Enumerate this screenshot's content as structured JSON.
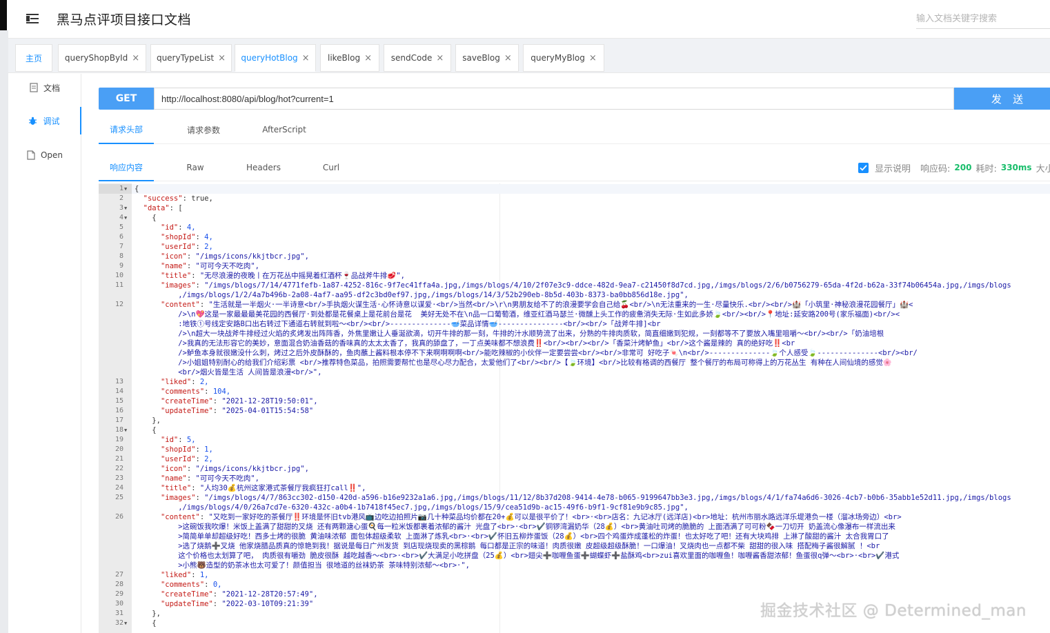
{
  "app": {
    "title": "黑马点评项目接口文档",
    "search_placeholder": "输入文档关键字搜索"
  },
  "tabs": [
    {
      "label": "主页"
    },
    {
      "label": "queryShopById"
    },
    {
      "label": "queryTypeList"
    },
    {
      "label": "queryHotBlog"
    },
    {
      "label": "likeBlog"
    },
    {
      "label": "sendCode"
    },
    {
      "label": "saveBlog"
    },
    {
      "label": "queryMyBlog"
    }
  ],
  "sidebar": {
    "items": [
      {
        "label": "文档"
      },
      {
        "label": "调试"
      },
      {
        "label": "Open"
      }
    ]
  },
  "request": {
    "method": "GET",
    "url": "http://localhost:8080/api/blog/hot?current=1",
    "send_label": "发 送"
  },
  "request_tabs": [
    {
      "label": "请求头部"
    },
    {
      "label": "请求参数"
    },
    {
      "label": "AfterScript"
    }
  ],
  "response_tabs": [
    {
      "label": "响应内容"
    },
    {
      "label": "Raw"
    },
    {
      "label": "Headers"
    },
    {
      "label": "Curl"
    }
  ],
  "response_meta": {
    "show_desc_label": "显示说明",
    "code_label": "响应码:",
    "code": "200",
    "time_label": "耗时:",
    "time": "330ms",
    "size_label": "大小"
  },
  "code_lines": [
    {
      "n": "1",
      "fold": true,
      "t": "{"
    },
    {
      "n": "2",
      "t": "  \"success\": true,"
    },
    {
      "n": "3",
      "fold": true,
      "t": "  \"data\": ["
    },
    {
      "n": "4",
      "fold": true,
      "t": "    {"
    },
    {
      "n": "5",
      "t": "      \"id\": 4,"
    },
    {
      "n": "6",
      "t": "      \"shopId\": 4,"
    },
    {
      "n": "7",
      "t": "      \"userId\": 2,"
    },
    {
      "n": "8",
      "t": "      \"icon\": \"/imgs/icons/kkjtbcr.jpg\","
    },
    {
      "n": "9",
      "t": "      \"name\": \"可可今天不吃肉\","
    },
    {
      "n": "10",
      "t": "      \"title\": \"无尽浪漫的夜晚丨在万花丛中摇晃着红酒杯🍷品战斧牛排🥩\","
    },
    {
      "n": "11",
      "t": "      \"images\": \"/imgs/blogs/7/14/4771fefb-1a87-4252-816c-9f7ec41ffa4a.jpg,/imgs/blogs/4/10/2f07e3c9-ddce-482d-9ea7-c21450f8d7cd.jpg,/imgs/blogs/2/6/b0756279-65da-4f2d-b62a-33f74b06454a.jpg,/imgs/blogs"
    },
    {
      "n": "",
      "t": "          ,/imgs/blogs/1/2/4a7b496b-2a08-4af7-aa95-df2c3bd0ef97.jpg,/imgs/blogs/14/3/52b290eb-8b5d-403b-8373-ba0bb856d18e.jpg\","
    },
    {
      "n": "12",
      "t": "      \"content\": \"生活就是一半烟火·一半诗意<br/>手执烟火谋生活·心怀诗意以谋爱·<br/>当然<br/>\\r\\n男朋友给不了的浪漫要学会自己给🍒<br/>\\n无法重来的一生·尽量快乐.<br/><br/>🏰「小筑里·神秘浪漫花园餐厅」🏰<"
    },
    {
      "n": "",
      "t": "          />\\n💖这是一家最最最美花园的西餐厅·到处都是花餐桌上是花前台是花  美好无处不在\\n品一口葡萄酒，维亚红酒马瑟兰·微醺上头工作的疲惫消失无际·生如此多娇🍃<br/><br/>📍地址:延安路200号(家乐福面)<br/><"
    },
    {
      "n": "",
      "t": "          :地铁①号线定安路B口出右转过下通道右转就到啦～<br/><br/>--------------🥣菜品详情🥣---------------<br/><br/>「战斧牛排]<br"
    },
    {
      "n": "",
      "t": "          />\\n超大一块战斧牛排经过火焰的炙烤发出阵阵香，外焦里嫩让人垂涎欲滴，切开牛排的那一刻，牛排的汁水顺势流了出来，分熟的牛排肉质软，简直细嫩到犯规，一刻都等不了要放入嘴里咀嚼～<br/><br/>「奶油培根"
    },
    {
      "n": "",
      "t": "          />我真的无法形容它的美妙，意面混合奶油香菇的香味真的太太太香了，我真的舔盘了，一丁点美味都不想浪费‼️<br/><br/><br/>「香菜汁烤鲈鱼」<br/>这个酱是辣的 真的绝好吃‼️<br"
    },
    {
      "n": "",
      "t": "          />鲈鱼本身就很嫩没什么刺，烤过之后外皮酥酥的，鱼肉蘸上酱料根本停不下来啊啊啊啊<br/>能吃辣椒的小伙伴一定要尝尝<br/><br/>非常可 好吃子🍬\\n<br/>--------------🍃个人感受🍃--------------<br/><br/"
    },
    {
      "n": "",
      "t": "          />小姐姐特别耐心的给我们介绍彩票 <br/>推荐特色菜品，拍照需要帮忙也是尽心尽力配合，太爱他们了<br/><br/>【🍃环境】<br/>比较有格调的西餐厅 整个餐厅的布局可称得上的万花丛生 有种在人间仙境的感觉🌸"
    },
    {
      "n": "",
      "t": "          <br/>烟火皆是生活 人间皆是浪漫<br/>\","
    },
    {
      "n": "13",
      "t": "      \"liked\": 2,"
    },
    {
      "n": "14",
      "t": "      \"comments\": 104,"
    },
    {
      "n": "15",
      "t": "      \"createTime\": \"2021-12-28T19:50:01\","
    },
    {
      "n": "16",
      "t": "      \"updateTime\": \"2025-04-01T15:54:58\""
    },
    {
      "n": "17",
      "t": "    },"
    },
    {
      "n": "18",
      "fold": true,
      "t": "    {"
    },
    {
      "n": "19",
      "t": "      \"id\": 5,"
    },
    {
      "n": "20",
      "t": "      \"shopId\": 1,"
    },
    {
      "n": "21",
      "t": "      \"userId\": 2,"
    },
    {
      "n": "22",
      "t": "      \"icon\": \"/imgs/icons/kkjtbcr.jpg\","
    },
    {
      "n": "23",
      "t": "      \"name\": \"可可今天不吃肉\","
    },
    {
      "n": "24",
      "t": "      \"title\": \"人均30💰杭州这家港式茶餐厅我疯狂打call‼️\","
    },
    {
      "n": "25",
      "t": "      \"images\": \"/imgs/blogs/4/7/863cc302-d150-420d-a596-b16e9232a1a6.jpg,/imgs/blogs/11/12/8b37d208-9414-4e78-b065-9199647bb3e3.jpg,/imgs/blogs/4/1/fa74a6d6-3026-4cb7-b0b6-35abb1e52d11.jpg,/imgs/blogs"
    },
    {
      "n": "",
      "t": "          ,/imgs/blogs/4/0/26a7cd7e-6320-432c-a0b4-1b7418f45ec7.jpg,/imgs/blogs/15/9/cea51d9b-ac15-49f6-b9f1-9cf81e9b9c85.jpg\","
    },
    {
      "n": "26",
      "t": "      \"content\": \"又吃到一家好吃的茶餐厅‼️环境是怀旧tvb港风📺边吃边拍照片📷几十种菜品均价都在20+💰可以是很平价了！<br>·<br>店名：九记冰厅(远洋店)<br>地址：杭州市丽水路远洋乐堤港负一楼（溜冰场旁边）<br>"
    },
    {
      "n": "",
      "t": "          >这碗饭我吹爆！米饭上盖满了甜甜的叉烧 还有两颗溏心蛋🍳每一粒米饭都裹着浓郁的酱汁 光盘了<br>·<br>✔️铜锣湾漏奶华（28💰）<br>黄油吐司烤的脆脆的 上面洒满了可可粉🍫一刀切开 奶盖流心像瀑布一样流出来"
    },
    {
      "n": "",
      "t": "          >简简单单却超级好吃！西多士烤的很脆 黄油味浓郁 面包体超级柔软 上面淋了炼乳<br>·<br>✔️怀旧五柳炸蛋饭（28💰）<br>四个鸡蛋炸成蓬松的炸蛋！也太好吃了吧！还有大块鸡排 上淋了酸甜的酱汁 太合我胃口了"
    },
    {
      "n": "",
      "t": "          >选了烧鹅➕叉烧 他家烧腊品质真的惊艳到我！据说是每日广州发货 到店现烧现卖的黑棕鹅 每口都是正宗的味道！肉质很嫩 皮超级超级酥脆！一口爆油！叉烧肉也一点都不柴 甜甜的很入味 搭配梅子酱很解腻 ！<br"
    },
    {
      "n": "",
      "t": "          这个价格也太划算了吧， 肉质很有嚼劲 脆皮很酥 越吃越香～<br>·<br>✔️大满足小吃拼盘（25💰）<br>翅尖➕咖喱鱼蛋➕蝴蝶虾➕盐酥鸡<br>zui喜欢里面的咖喱鱼！咖喱酱香甜浓郁！鱼蛋很q弹～<br>·<br>✔️港式"
    },
    {
      "n": "",
      "t": "          >小熊🐻造型的奶茶冰也太可爱了！颜值担当 很地道的丝袜奶茶 茶味特别浓郁～<br>·\","
    },
    {
      "n": "27",
      "t": "      \"liked\": 1,"
    },
    {
      "n": "28",
      "t": "      \"comments\": 0,"
    },
    {
      "n": "29",
      "t": "      \"createTime\": \"2021-12-28T20:57:49\","
    },
    {
      "n": "30",
      "t": "      \"updateTime\": \"2022-03-10T09:21:39\""
    },
    {
      "n": "31",
      "t": "    },"
    },
    {
      "n": "32",
      "fold": true,
      "t": "    {"
    }
  ],
  "watermark": "掘金技术社区 @ Determined_man"
}
